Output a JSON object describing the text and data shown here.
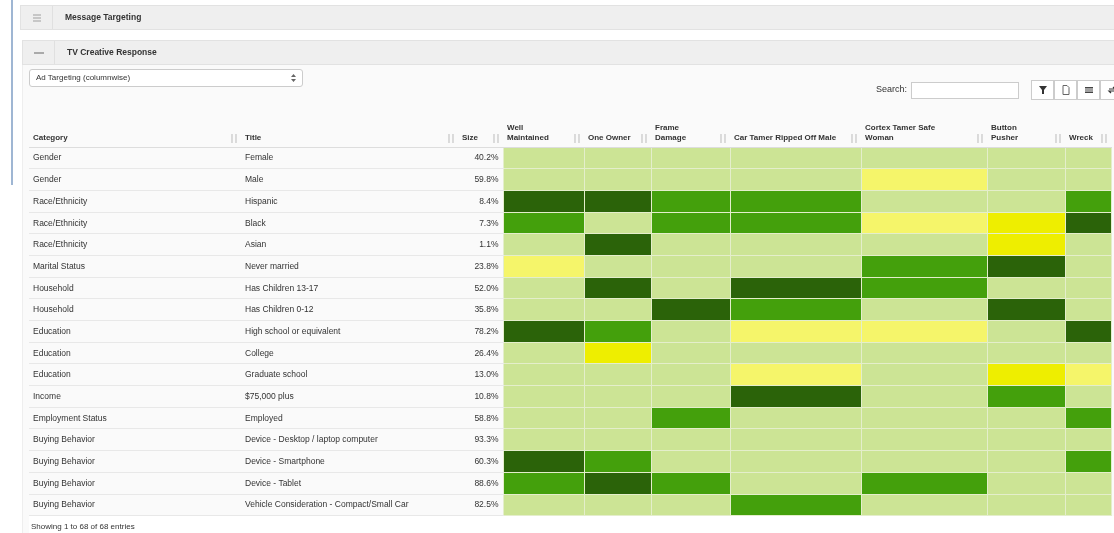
{
  "panels": [
    {
      "title": "Message Targeting",
      "expanded": false
    },
    {
      "title": "TV Creative Response",
      "expanded": true
    }
  ],
  "targeting_select": {
    "value": "Ad Targeting (columnwise)"
  },
  "search": {
    "label": "Search:"
  },
  "toolbar": [
    {
      "kind": "filter"
    },
    {
      "kind": "export"
    },
    {
      "kind": "columns"
    },
    {
      "kind": "refresh"
    }
  ],
  "table": {
    "columns": [
      "Category",
      "Title",
      "Size",
      "Well Maintained",
      "One Owner",
      "Frame Damage",
      "Car Tamer Ripped Off Male",
      "Cortex Tamer Safe Woman",
      "Button Pusher",
      "Wreck"
    ],
    "rows": [
      {
        "category": "Gender",
        "title": "Female",
        "size": "40.2%",
        "cells": [
          {
            "color": "#cce495"
          },
          {
            "color": "#cce495"
          },
          {
            "color": "#cce495"
          },
          {
            "color": "#cce495"
          },
          {
            "color": "#cce495"
          },
          {
            "color": "#cce495"
          },
          {
            "color": "#cce495"
          }
        ]
      },
      {
        "category": "Gender",
        "title": "Male",
        "size": "59.8%",
        "cells": [
          {
            "color": "#cce495"
          },
          {
            "color": "#cce495"
          },
          {
            "color": "#cce495"
          },
          {
            "color": "#cce495"
          },
          {
            "color": "#f5f56a"
          },
          {
            "color": "#cce495"
          },
          {
            "color": "#cce495"
          }
        ]
      },
      {
        "category": "Race/Ethnicity",
        "title": "Hispanic",
        "size": "8.4%",
        "cells": [
          {
            "color": "#2b6309"
          },
          {
            "color": "#2b6309"
          },
          {
            "color": "#44a00c"
          },
          {
            "color": "#44a00c"
          },
          {
            "color": "#cce495"
          },
          {
            "color": "#cce495"
          },
          {
            "color": "#44a00c"
          }
        ]
      },
      {
        "category": "Race/Ethnicity",
        "title": "Black",
        "size": "7.3%",
        "cells": [
          {
            "color": "#44a00c"
          },
          {
            "color": "#cce495"
          },
          {
            "color": "#44a00c"
          },
          {
            "color": "#44a00c"
          },
          {
            "color": "#f5f56a"
          },
          {
            "color": "#eeee00"
          },
          {
            "color": "#2b6309"
          }
        ]
      },
      {
        "category": "Race/Ethnicity",
        "title": "Asian",
        "size": "1.1%",
        "cells": [
          {
            "color": "#cce495"
          },
          {
            "color": "#2b6309"
          },
          {
            "color": "#cce495"
          },
          {
            "color": "#cce495"
          },
          {
            "color": "#cce495"
          },
          {
            "color": "#eeee00"
          },
          {
            "color": "#cce495"
          }
        ]
      },
      {
        "category": "Marital Status",
        "title": "Never married",
        "size": "23.8%",
        "cells": [
          {
            "color": "#f5f56a"
          },
          {
            "color": "#cce495"
          },
          {
            "color": "#cce495"
          },
          {
            "color": "#cce495"
          },
          {
            "color": "#44a00c"
          },
          {
            "color": "#2b6309"
          },
          {
            "color": "#cce495"
          }
        ]
      },
      {
        "category": "Household",
        "title": "Has Children 13-17",
        "size": "52.0%",
        "cells": [
          {
            "color": "#cce495"
          },
          {
            "color": "#2b6309"
          },
          {
            "color": "#cce495"
          },
          {
            "color": "#2b6309"
          },
          {
            "color": "#44a00c"
          },
          {
            "color": "#cce495"
          },
          {
            "color": "#cce495"
          }
        ]
      },
      {
        "category": "Household",
        "title": "Has Children 0-12",
        "size": "35.8%",
        "cells": [
          {
            "color": "#cce495"
          },
          {
            "color": "#cce495"
          },
          {
            "color": "#2b6309"
          },
          {
            "color": "#44a00c"
          },
          {
            "color": "#cce495"
          },
          {
            "color": "#2b6309"
          },
          {
            "color": "#cce495"
          }
        ]
      },
      {
        "category": "Education",
        "title": "High school or equivalent",
        "size": "78.2%",
        "cells": [
          {
            "color": "#2b6309"
          },
          {
            "color": "#44a00c"
          },
          {
            "color": "#cce495"
          },
          {
            "color": "#f5f56a"
          },
          {
            "color": "#f5f56a"
          },
          {
            "color": "#cce495"
          },
          {
            "color": "#2b6309"
          }
        ]
      },
      {
        "category": "Education",
        "title": "College",
        "size": "26.4%",
        "cells": [
          {
            "color": "#cce495"
          },
          {
            "color": "#eeee00"
          },
          {
            "color": "#cce495"
          },
          {
            "color": "#cce495"
          },
          {
            "color": "#cce495"
          },
          {
            "color": "#cce495"
          },
          {
            "color": "#cce495"
          }
        ]
      },
      {
        "category": "Education",
        "title": "Graduate school",
        "size": "13.0%",
        "cells": [
          {
            "color": "#cce495"
          },
          {
            "color": "#cce495"
          },
          {
            "color": "#cce495"
          },
          {
            "color": "#f5f56a"
          },
          {
            "color": "#cce495"
          },
          {
            "color": "#eeee00"
          },
          {
            "color": "#f5f56a"
          }
        ]
      },
      {
        "category": "Income",
        "title": "$75,000 plus",
        "size": "10.8%",
        "cells": [
          {
            "color": "#cce495"
          },
          {
            "color": "#cce495"
          },
          {
            "color": "#cce495"
          },
          {
            "color": "#2b6309"
          },
          {
            "color": "#cce495"
          },
          {
            "color": "#44a00c"
          },
          {
            "color": "#cce495"
          }
        ]
      },
      {
        "category": "Employment Status",
        "title": "Employed",
        "size": "58.8%",
        "cells": [
          {
            "color": "#cce495"
          },
          {
            "color": "#cce495"
          },
          {
            "color": "#44a00c"
          },
          {
            "color": "#cce495"
          },
          {
            "color": "#cce495"
          },
          {
            "color": "#cce495"
          },
          {
            "color": "#44a00c"
          }
        ]
      },
      {
        "category": "Buying Behavior",
        "title": "Device - Desktop / laptop computer",
        "size": "93.3%",
        "cells": [
          {
            "color": "#cce495"
          },
          {
            "color": "#cce495"
          },
          {
            "color": "#cce495"
          },
          {
            "color": "#cce495"
          },
          {
            "color": "#cce495"
          },
          {
            "color": "#cce495"
          },
          {
            "color": "#cce495"
          }
        ]
      },
      {
        "category": "Buying Behavior",
        "title": "Device - Smartphone",
        "size": "60.3%",
        "cells": [
          {
            "color": "#2b6309"
          },
          {
            "color": "#44a00c"
          },
          {
            "color": "#cce495"
          },
          {
            "color": "#cce495"
          },
          {
            "color": "#cce495"
          },
          {
            "color": "#cce495"
          },
          {
            "color": "#44a00c"
          }
        ]
      },
      {
        "category": "Buying Behavior",
        "title": "Device - Tablet",
        "size": "88.6%",
        "cells": [
          {
            "color": "#44a00c"
          },
          {
            "color": "#2b6309"
          },
          {
            "color": "#44a00c"
          },
          {
            "color": "#cce495"
          },
          {
            "color": "#44a00c"
          },
          {
            "color": "#cce495"
          },
          {
            "color": "#cce495"
          }
        ]
      },
      {
        "category": "Buying Behavior",
        "title": "Vehicle Consideration - Compact/Small Car",
        "size": "82.5%",
        "cells": [
          {
            "color": "#cce495"
          },
          {
            "color": "#cce495"
          },
          {
            "color": "#cce495"
          },
          {
            "color": "#44a00c"
          },
          {
            "color": "#cce495"
          },
          {
            "color": "#cce495"
          },
          {
            "color": "#cce495"
          }
        ]
      }
    ]
  },
  "footer": "Showing 1 to 68 of 68 entries"
}
